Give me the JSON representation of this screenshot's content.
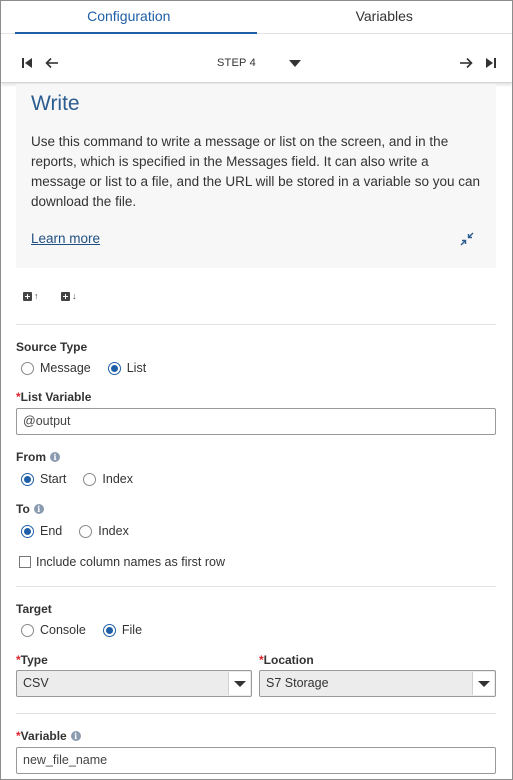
{
  "tabs": [
    {
      "label": "Configuration",
      "active": true
    },
    {
      "label": "Variables",
      "active": false
    }
  ],
  "step_nav": {
    "step_label": "STEP 4",
    "icons": [
      "first-step-icon",
      "prev-step-icon",
      "next-step-icon",
      "last-step-icon"
    ]
  },
  "info": {
    "title": "Write",
    "description": "Use this command to write a message or list on the screen, and in the reports, which is specified in the Messages field. It can also write a message or list to a file, and the URL will be stored in a variable so you can download the file.",
    "learn_more": "Learn more"
  },
  "add_buttons": {
    "above_arrow": "↑",
    "below_arrow": "↓"
  },
  "source_type": {
    "label": "Source Type",
    "options": [
      "Message",
      "List"
    ],
    "selected": "List"
  },
  "list_variable": {
    "required_mark": "*",
    "label": "List Variable",
    "value": "@output"
  },
  "from": {
    "label": "From",
    "options": [
      "Start",
      "Index"
    ],
    "selected": "Start"
  },
  "to": {
    "label": "To",
    "options": [
      "End",
      "Index"
    ],
    "selected": "End"
  },
  "include_column_names": {
    "label": "Include column names as first row",
    "checked": false
  },
  "target": {
    "label": "Target",
    "options": [
      "Console",
      "File"
    ],
    "selected": "File"
  },
  "type": {
    "required_mark": "*",
    "label": "Type",
    "value": "CSV"
  },
  "location": {
    "required_mark": "*",
    "label": "Location",
    "value": "S7 Storage"
  },
  "variable": {
    "required_mark": "*",
    "label": "Variable",
    "value": "new_file_name"
  },
  "colors": {
    "accent": "#1f5fa8",
    "title": "#2b5d91",
    "required": "#d9232d",
    "panel": "#f7f7f7"
  }
}
